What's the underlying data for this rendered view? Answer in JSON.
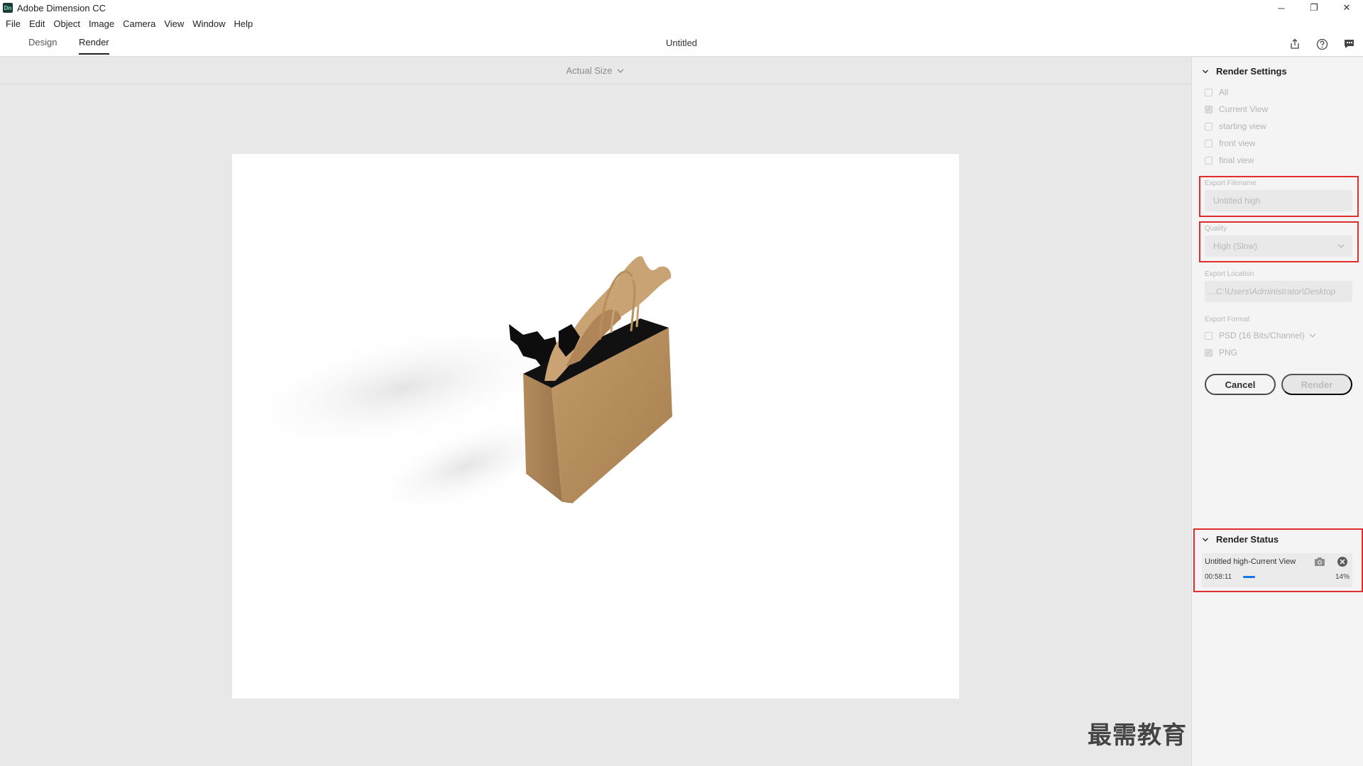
{
  "window": {
    "app_icon_text": "Dn",
    "title": "Adobe Dimension CC",
    "controls": {
      "minimize": "─",
      "restore": "❐",
      "close": "✕"
    }
  },
  "menu": [
    "File",
    "Edit",
    "Object",
    "Image",
    "Camera",
    "View",
    "Window",
    "Help"
  ],
  "tabs": [
    {
      "label": "Design",
      "active": false
    },
    {
      "label": "Render",
      "active": true
    }
  ],
  "document_title": "Untitled",
  "toolbar_icons": [
    "share-icon",
    "help-icon",
    "comment-icon"
  ],
  "canvas": {
    "zoom_label": "Actual Size",
    "watermark": "最需教育"
  },
  "render_settings": {
    "header": "Render Settings",
    "views": [
      {
        "label": "All",
        "checked": false
      },
      {
        "label": "Current View",
        "checked": true
      },
      {
        "label": "starting view",
        "checked": false
      },
      {
        "label": "front view",
        "checked": false
      },
      {
        "label": "final view",
        "checked": false
      }
    ],
    "export_filename_label": "Export Filename",
    "export_filename_value": "Untitled high",
    "quality_label": "Quality",
    "quality_value": "High (Slow)",
    "export_location_label": "Export Location",
    "export_location_value": "...C:\\Users\\Administrator\\Desktop",
    "export_format_label": "Export Format",
    "formats": [
      {
        "label": "PSD (16 Bits/Channel)",
        "checked": false,
        "has_dropdown": true
      },
      {
        "label": "PNG",
        "checked": true,
        "has_dropdown": false
      }
    ],
    "cancel_label": "Cancel",
    "render_label": "Render"
  },
  "render_status": {
    "header": "Render Status",
    "job_name": "Untitled high-Current View",
    "elapsed": "00:58:11",
    "progress_percent": 14,
    "progress_label": "14%"
  },
  "colors": {
    "accent_blue": "#1473e6",
    "highlight_red": "#e02e2e",
    "bag_kraft": "#b48a5a"
  }
}
